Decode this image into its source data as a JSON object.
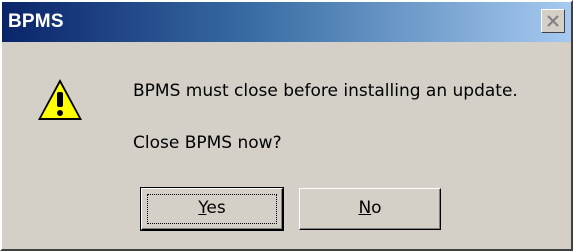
{
  "window": {
    "title": "BPMS",
    "close_icon": "close-x-icon"
  },
  "message": {
    "icon": "warning-icon",
    "line1": "BPMS must close before installing an update.",
    "line2": "Close BPMS now?"
  },
  "buttons": {
    "yes": {
      "mnemonic": "Y",
      "rest": "es"
    },
    "no": {
      "mnemonic": "N",
      "rest": "o"
    }
  }
}
